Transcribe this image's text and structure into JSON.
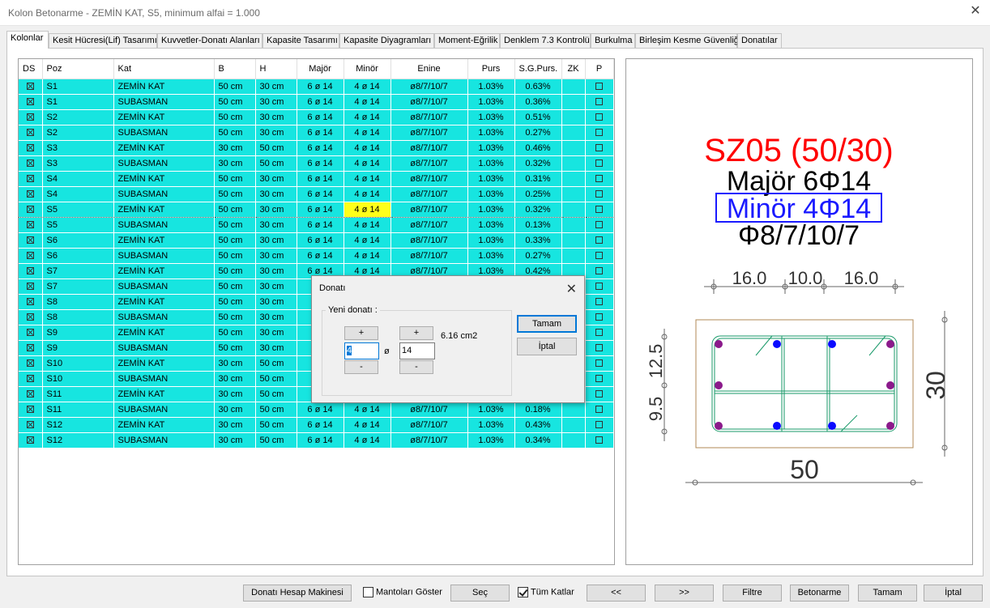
{
  "window": {
    "title": "Kolon Betonarme - ZEMİN KAT, S5, minimum alfai = 1.000",
    "close_glyph": "✕"
  },
  "tabs": [
    "Kolonlar",
    "Kesit Hücresi(Lif) Tasarımı",
    "Kuvvetler-Donatı Alanları",
    "Kapasite Tasarımı",
    "Kapasite Diyagramları",
    "Moment-Eğrilik",
    "Denklem 7.3 Kontrolü",
    "Burkulma",
    "Birleşim Kesme Güvenliği",
    "Donatılar"
  ],
  "table": {
    "headers": [
      "DS",
      "Poz",
      "Kat",
      "B",
      "H",
      "Majör",
      "Minör",
      "Enine",
      "Purs",
      "S.G.Purs.",
      "ZK",
      "P"
    ],
    "rows": [
      [
        "S1",
        "ZEMİN KAT",
        "50 cm",
        "30 cm",
        "6 ø 14",
        "4 ø 14",
        "ø8/7/10/7",
        "1.03%",
        "0.63%"
      ],
      [
        "S1",
        "SUBASMAN",
        "50 cm",
        "30 cm",
        "6 ø 14",
        "4 ø 14",
        "ø8/7/10/7",
        "1.03%",
        "0.36%"
      ],
      [
        "S2",
        "ZEMİN KAT",
        "50 cm",
        "30 cm",
        "6 ø 14",
        "4 ø 14",
        "ø8/7/10/7",
        "1.03%",
        "0.51%"
      ],
      [
        "S2",
        "SUBASMAN",
        "50 cm",
        "30 cm",
        "6 ø 14",
        "4 ø 14",
        "ø8/7/10/7",
        "1.03%",
        "0.27%"
      ],
      [
        "S3",
        "ZEMİN KAT",
        "30 cm",
        "50 cm",
        "6 ø 14",
        "4 ø 14",
        "ø8/7/10/7",
        "1.03%",
        "0.46%"
      ],
      [
        "S3",
        "SUBASMAN",
        "30 cm",
        "50 cm",
        "6 ø 14",
        "4 ø 14",
        "ø8/7/10/7",
        "1.03%",
        "0.32%"
      ],
      [
        "S4",
        "ZEMİN KAT",
        "50 cm",
        "30 cm",
        "6 ø 14",
        "4 ø 14",
        "ø8/7/10/7",
        "1.03%",
        "0.31%"
      ],
      [
        "S4",
        "SUBASMAN",
        "50 cm",
        "30 cm",
        "6 ø 14",
        "4 ø 14",
        "ø8/7/10/7",
        "1.03%",
        "0.25%"
      ],
      [
        "S5",
        "ZEMİN KAT",
        "50 cm",
        "30 cm",
        "6 ø 14",
        "4 ø 14",
        "ø8/7/10/7",
        "1.03%",
        "0.32%"
      ],
      [
        "S5",
        "SUBASMAN",
        "50 cm",
        "30 cm",
        "6 ø 14",
        "4 ø 14",
        "ø8/7/10/7",
        "1.03%",
        "0.13%"
      ],
      [
        "S6",
        "ZEMİN KAT",
        "50 cm",
        "30 cm",
        "6 ø 14",
        "4 ø 14",
        "ø8/7/10/7",
        "1.03%",
        "0.33%"
      ],
      [
        "S6",
        "SUBASMAN",
        "50 cm",
        "30 cm",
        "6 ø 14",
        "4 ø 14",
        "ø8/7/10/7",
        "1.03%",
        "0.27%"
      ],
      [
        "S7",
        "ZEMİN KAT",
        "50 cm",
        "30 cm",
        "6 ø 14",
        "4 ø 14",
        "ø8/7/10/7",
        "1.03%",
        "0.42%"
      ],
      [
        "S7",
        "SUBASMAN",
        "50 cm",
        "30 cm",
        "6",
        "",
        "",
        "",
        ""
      ],
      [
        "S8",
        "ZEMİN KAT",
        "50 cm",
        "30 cm",
        "6",
        "",
        "",
        "",
        ""
      ],
      [
        "S8",
        "SUBASMAN",
        "50 cm",
        "30 cm",
        "6",
        "",
        "",
        "",
        ""
      ],
      [
        "S9",
        "ZEMİN KAT",
        "50 cm",
        "30 cm",
        "6",
        "",
        "",
        "",
        ""
      ],
      [
        "S9",
        "SUBASMAN",
        "50 cm",
        "30 cm",
        "6",
        "",
        "",
        "",
        ""
      ],
      [
        "S10",
        "ZEMİN KAT",
        "30 cm",
        "50 cm",
        "6",
        "",
        "",
        "",
        ""
      ],
      [
        "S10",
        "SUBASMAN",
        "30 cm",
        "50 cm",
        "6",
        "",
        "",
        "",
        ""
      ],
      [
        "S11",
        "ZEMİN KAT",
        "30 cm",
        "50 cm",
        "6",
        "",
        "",
        "",
        ""
      ],
      [
        "S11",
        "SUBASMAN",
        "30 cm",
        "50 cm",
        "6 ø 14",
        "4 ø 14",
        "ø8/7/10/7",
        "1.03%",
        "0.18%"
      ],
      [
        "S12",
        "ZEMİN KAT",
        "30 cm",
        "50 cm",
        "6 ø 14",
        "4 ø 14",
        "ø8/7/10/7",
        "1.03%",
        "0.43%"
      ],
      [
        "S12",
        "SUBASMAN",
        "30 cm",
        "50 cm",
        "6 ø 14",
        "4 ø 14",
        "ø8/7/10/7",
        "1.03%",
        "0.34%"
      ]
    ],
    "selected_row": 8,
    "highlighted_cell": "Minör",
    "row_color": "#17e5e0",
    "highlight_color": "#ffff1a"
  },
  "section": {
    "title": "SZ05 (50/30)",
    "major": "Majör 6Φ14",
    "minor": "Minör 4Φ14",
    "stirrup": "Φ8/7/10/7",
    "top_dims": [
      "16.0",
      "10.0",
      "16.0"
    ],
    "left_dims": [
      "12.5",
      "9.5"
    ],
    "right_dim": "30",
    "bottom_dim": "50",
    "colors": {
      "title": "#ff0000",
      "minor": "#1a1aff",
      "bar_major": "#8b1a8b",
      "bar_minor": "#0a0aff",
      "stirrup": "#1a9a6a"
    }
  },
  "dialog": {
    "title": "Donatı",
    "group": "Yeni donatı :",
    "plus": "+",
    "minus": "-",
    "count": "4",
    "diameter": "14",
    "diam_symbol": "ø",
    "area": "6.16 cm2",
    "ok": "Tamam",
    "cancel": "İptal"
  },
  "bottom": {
    "calc": "Donatı Hesap Makinesi",
    "mantolar": "Mantoları Göster",
    "sec": "Seç",
    "tum_katlar": "Tüm Katlar",
    "prev": "<<",
    "next": ">>",
    "filtre": "Filtre",
    "betonarme": "Betonarme",
    "tamam": "Tamam",
    "iptal": "İptal"
  }
}
